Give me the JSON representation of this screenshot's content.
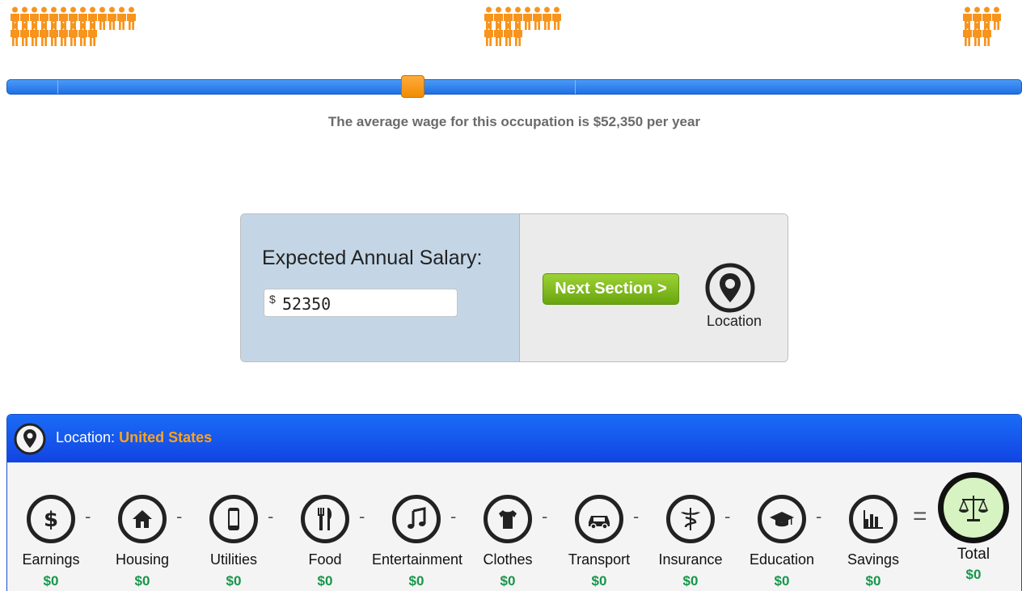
{
  "wage": {
    "message": "The average wage for this occupation is $52,350 per year",
    "slider_position_pct": 40
  },
  "salary_card": {
    "label": "Expected Annual Salary:",
    "currency_symbol": "$",
    "salary_value": "52350",
    "next_button_label": "Next Section >",
    "next_icon": "location-pin-icon",
    "next_icon_label": "Location"
  },
  "panel": {
    "location_label": "Location:",
    "location_value": "United States",
    "separator": "-",
    "equals": "=",
    "categories": [
      {
        "icon": "dollar-icon",
        "label": "Earnings",
        "amount": "$0"
      },
      {
        "icon": "house-icon",
        "label": "Housing",
        "amount": "$0"
      },
      {
        "icon": "phone-icon",
        "label": "Utilities",
        "amount": "$0"
      },
      {
        "icon": "fork-knife-icon",
        "label": "Food",
        "amount": "$0"
      },
      {
        "icon": "music-note-icon",
        "label": "Entertainment",
        "amount": "$0"
      },
      {
        "icon": "tshirt-icon",
        "label": "Clothes",
        "amount": "$0"
      },
      {
        "icon": "car-icon",
        "label": "Transport",
        "amount": "$0"
      },
      {
        "icon": "caduceus-icon",
        "label": "Insurance",
        "amount": "$0"
      },
      {
        "icon": "graduation-cap-icon",
        "label": "Education",
        "amount": "$0"
      },
      {
        "icon": "bar-chart-icon",
        "label": "Savings",
        "amount": "$0"
      }
    ],
    "total": {
      "icon": "scales-icon",
      "label": "Total",
      "amount": "$0"
    }
  },
  "colors": {
    "accent_orange": "#f7941d",
    "slider_blue": "#1e6fe6",
    "money_green": "#16964a",
    "button_green": "#7dbb1c"
  }
}
